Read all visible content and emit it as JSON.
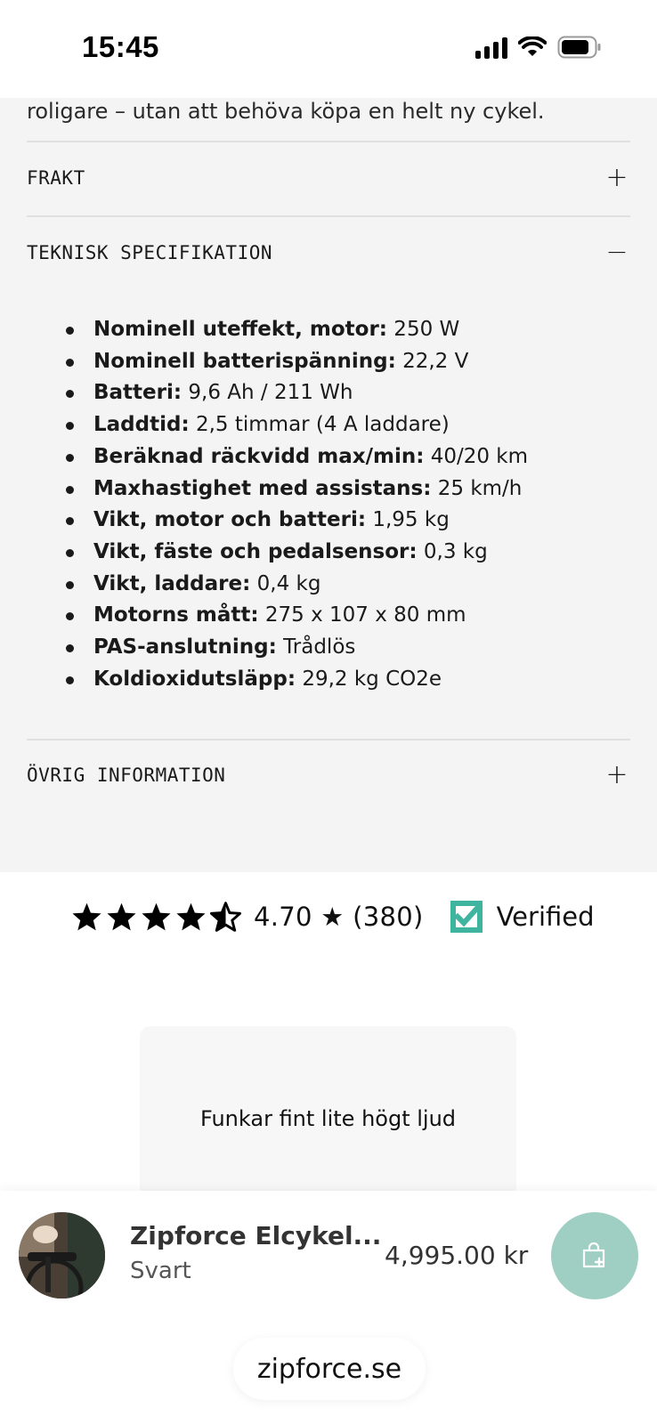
{
  "status_bar": {
    "time": "15:45",
    "icons": [
      "cellular-signal-icon",
      "wifi-icon",
      "battery-icon"
    ]
  },
  "intro_text": "roligare – utan att behöva köpa en helt ny cykel.",
  "accordion": {
    "shipping": {
      "title": "FRAKT",
      "toggle": "+"
    },
    "tech_spec": {
      "title": "TEKNISK SPECIFIKATION",
      "toggle": "−",
      "items": [
        {
          "label": "Nominell uteffekt, motor:",
          "value": " 250 W"
        },
        {
          "label": "Nominell batterispänning:",
          "value": " 22,2 V"
        },
        {
          "label": "Batteri:",
          "value": " 9,6 Ah / 211 Wh"
        },
        {
          "label": "Laddtid:",
          "value": " 2,5 timmar (4 A laddare)"
        },
        {
          "label": "Beräknad räckvidd max/min:",
          "value": " 40/20 km"
        },
        {
          "label": "Maxhastighet med assistans:",
          "value": " 25 km/h"
        },
        {
          "label": "Vikt, motor och batteri:",
          "value": " 1,95 kg"
        },
        {
          "label": "Vikt, fäste och pedalsensor:",
          "value": " 0,3 kg"
        },
        {
          "label": "Vikt, laddare:",
          "value": " 0,4 kg"
        },
        {
          "label": "Motorns mått:",
          "value": " 275 x 107 x 80 mm"
        },
        {
          "label": "PAS-anslutning:",
          "value": " Trådlös"
        },
        {
          "label": "Koldioxidutsläpp:",
          "value": " 29,2 kg CO2e"
        }
      ]
    },
    "other_info": {
      "title": "ÖVRIG INFORMATION",
      "toggle": "+"
    }
  },
  "rating": {
    "stars_value": 4.7,
    "stars_max": 5,
    "text": "4.70 ★ (380)",
    "verified_label": "Verified",
    "verified_color": "#3fb5a0"
  },
  "review": {
    "text": "Funkar fint lite högt ljud"
  },
  "product_bar": {
    "name": "Zipforce Elcykel...",
    "variant": "Svart",
    "price": "4,995.00 kr",
    "cart_color": "#9fcfc2"
  },
  "url": "zipforce.se"
}
